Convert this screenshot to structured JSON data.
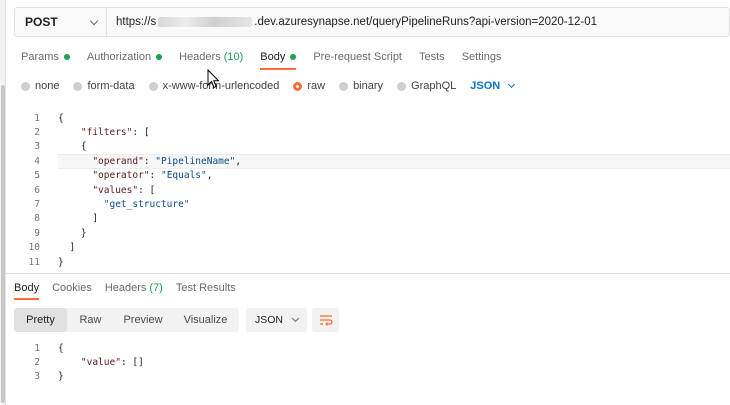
{
  "request": {
    "method": "POST",
    "url_prefix": "https://s",
    "url_suffix": ".dev.azuresynapse.net/queryPipelineRuns?api-version=2020-12-01"
  },
  "request_tabs": [
    {
      "label": "Params",
      "dot": true,
      "count": "",
      "active": false
    },
    {
      "label": "Authorization",
      "dot": true,
      "count": "",
      "active": false
    },
    {
      "label": "Headers",
      "dot": false,
      "count": "(10)",
      "active": false
    },
    {
      "label": "Body",
      "dot": true,
      "count": "",
      "active": true
    },
    {
      "label": "Pre-request Script",
      "dot": false,
      "count": "",
      "active": false
    },
    {
      "label": "Tests",
      "dot": false,
      "count": "",
      "active": false
    },
    {
      "label": "Settings",
      "dot": false,
      "count": "",
      "active": false
    }
  ],
  "body_types": [
    {
      "label": "none",
      "selected": false
    },
    {
      "label": "form-data",
      "selected": false
    },
    {
      "label": "x-www-form-urlencoded",
      "selected": false
    },
    {
      "label": "raw",
      "selected": true
    },
    {
      "label": "binary",
      "selected": false
    },
    {
      "label": "GraphQL",
      "selected": false
    }
  ],
  "body_language": "JSON",
  "request_body_lines": [
    {
      "n": "1",
      "text": "{"
    },
    {
      "n": "2",
      "text": "    \"filters\": ["
    },
    {
      "n": "3",
      "text": "    {"
    },
    {
      "n": "4",
      "text": "      \"operand\": \"PipelineName\","
    },
    {
      "n": "5",
      "text": "      \"operator\": \"Equals\","
    },
    {
      "n": "6",
      "text": "      \"values\": ["
    },
    {
      "n": "7",
      "text": "        \"get_structure\""
    },
    {
      "n": "8",
      "text": "      ]"
    },
    {
      "n": "9",
      "text": "    }"
    },
    {
      "n": "10",
      "text": "  ]"
    },
    {
      "n": "11",
      "text": "}"
    }
  ],
  "response_tabs": [
    {
      "label": "Body",
      "count": "",
      "active": true
    },
    {
      "label": "Cookies",
      "count": "",
      "active": false
    },
    {
      "label": "Headers",
      "count": "(7)",
      "active": false
    },
    {
      "label": "Test Results",
      "count": "",
      "active": false
    }
  ],
  "response_views": [
    {
      "label": "Pretty",
      "active": true
    },
    {
      "label": "Raw",
      "active": false
    },
    {
      "label": "Preview",
      "active": false
    },
    {
      "label": "Visualize",
      "active": false
    }
  ],
  "response_format": "JSON",
  "response_body_lines": [
    {
      "n": "1",
      "text": "{"
    },
    {
      "n": "2",
      "text": "    \"value\": []"
    },
    {
      "n": "3",
      "text": "}"
    }
  ],
  "colors": {
    "accent": "#ff6c37",
    "status_dot": "#1d9f4f",
    "link": "#0b74c6"
  }
}
